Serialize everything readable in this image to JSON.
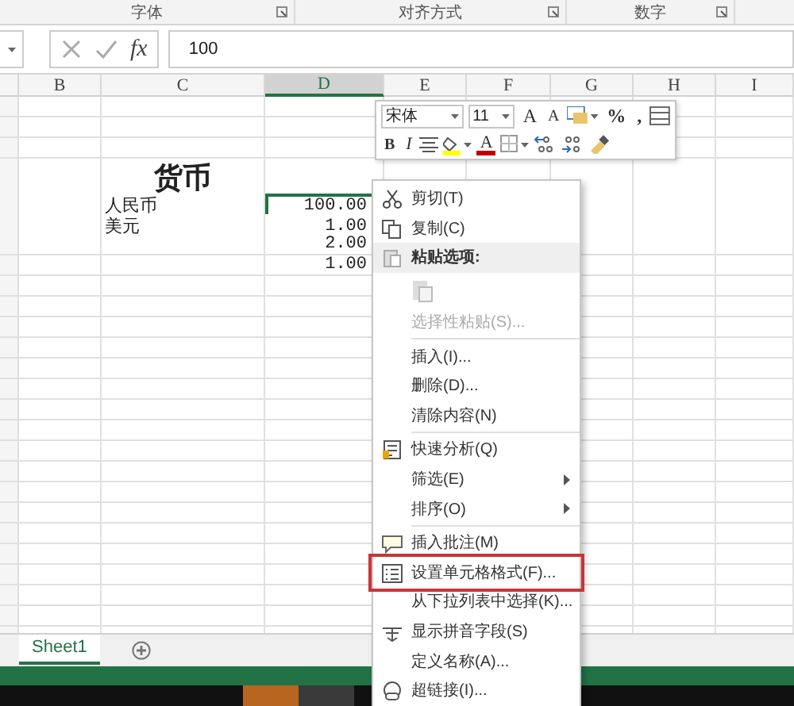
{
  "ribbon_groups": [
    {
      "label": "字体"
    },
    {
      "label": "对齐方式"
    },
    {
      "label": "数字"
    }
  ],
  "formula_bar": {
    "function_label": "fx",
    "value": "100"
  },
  "columns": [
    {
      "label": "B",
      "selected": false
    },
    {
      "label": "C",
      "selected": false
    },
    {
      "label": "D",
      "selected": true
    },
    {
      "label": "E",
      "selected": false
    },
    {
      "label": "F",
      "selected": false
    },
    {
      "label": "G",
      "selected": false
    },
    {
      "label": "H",
      "selected": false
    },
    {
      "label": "I",
      "selected": false
    }
  ],
  "rows": [
    {
      "kind": "title",
      "c": "货币"
    },
    {
      "kind": "data",
      "c": "人民币",
      "d": "100.00",
      "selected": true
    },
    {
      "kind": "data",
      "c": "美元",
      "d": "1.00",
      "selected": false
    },
    {
      "kind": "data",
      "d": "2.00",
      "selected": false
    },
    {
      "kind": "data",
      "d": "1.00",
      "selected": false
    }
  ],
  "mini_toolbar": {
    "top_tools": [
      {
        "kind": "font-name",
        "value": "宋体"
      },
      {
        "kind": "font-size",
        "value": "11"
      },
      {
        "kind": "grow-font",
        "label": "A"
      },
      {
        "kind": "shrink-font",
        "label": "A"
      },
      {
        "kind": "number-format"
      },
      {
        "kind": "text",
        "label": "%"
      },
      {
        "kind": "text",
        "label": ","
      },
      {
        "kind": "table-format"
      }
    ],
    "bottom_tools": [
      {
        "kind": "bold",
        "label": "B"
      },
      {
        "kind": "italic",
        "label": "I"
      },
      {
        "kind": "align-center"
      },
      {
        "kind": "fill-color"
      },
      {
        "kind": "font-color",
        "label": "A"
      },
      {
        "kind": "borders"
      },
      {
        "kind": "increase-decimal"
      },
      {
        "kind": "decrease-decimal"
      },
      {
        "kind": "format-painter"
      }
    ]
  },
  "context_menu": {
    "sections": [
      [
        {
          "kind": "item",
          "label": "剪切(T)"
        },
        {
          "kind": "item",
          "label": "复制(C)"
        },
        {
          "kind": "header",
          "label": "粘贴选项:"
        },
        {
          "kind": "paste-options"
        },
        {
          "kind": "item",
          "label": "选择性粘贴(S)...",
          "disabled": true
        }
      ],
      [
        {
          "kind": "item",
          "label": "插入(I)..."
        },
        {
          "kind": "item",
          "label": "删除(D)..."
        },
        {
          "kind": "item",
          "label": "清除内容(N)"
        }
      ],
      [
        {
          "kind": "item",
          "label": "快速分析(Q)"
        },
        {
          "kind": "item",
          "label": "筛选(E)",
          "submenu": true
        },
        {
          "kind": "item",
          "label": "排序(O)",
          "submenu": true
        }
      ],
      [
        {
          "kind": "item",
          "label": "插入批注(M)"
        },
        {
          "kind": "item",
          "label": "设置单元格格式(F)...",
          "outlined": true
        },
        {
          "kind": "item",
          "label": "从下拉列表中选择(K)..."
        },
        {
          "kind": "item",
          "label": "显示拼音字段(S)"
        },
        {
          "kind": "item",
          "label": "定义名称(A)..."
        },
        {
          "kind": "item",
          "label": "超链接(I)..."
        }
      ]
    ]
  },
  "sheet_tabs": [
    {
      "label": "Sheet1",
      "selected": true
    }
  ]
}
